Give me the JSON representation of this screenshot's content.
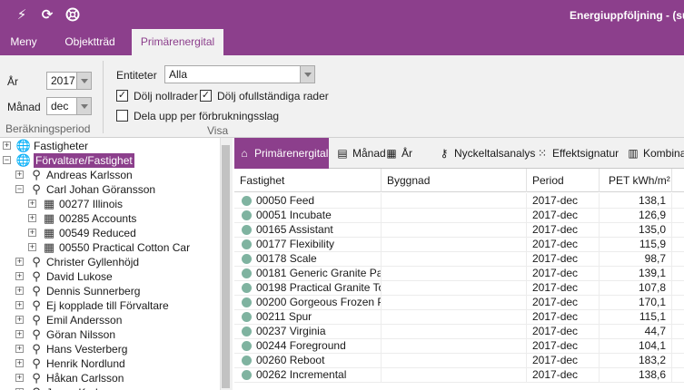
{
  "titlebar": {
    "title": "Energiuppföljning -   (su",
    "quick_icons": [
      "lightning-icon",
      "refresh-icon",
      "lifebuoy-icon"
    ]
  },
  "ribbon_tabs": [
    {
      "label": "Meny"
    },
    {
      "label": "Objektträd"
    },
    {
      "label": "Primärenergital"
    }
  ],
  "ribbon": {
    "year_label": "År",
    "year_value": "2017",
    "month_label": "Månad",
    "month_value": "dec",
    "period_group_label": "Beräkningsperiod",
    "entity_label": "Entiteter",
    "entity_value": "Alla",
    "hide_zero_label": "Dölj nollrader",
    "hide_zero_checked": true,
    "hide_incomplete_label": "Dölj ofullständiga rader",
    "hide_incomplete_checked": true,
    "split_label": "Dela upp per förbrukningsslag",
    "split_checked": false,
    "view_group_label": "Visa"
  },
  "tree": [
    {
      "level": 0,
      "label": "Fastigheter",
      "expander": "+",
      "icon": "globe-icon"
    },
    {
      "level": 0,
      "label": "Förvaltare/Fastighet",
      "expander": "−",
      "icon": "globe-icon",
      "selected": true
    },
    {
      "level": 1,
      "label": "Andreas Karlsson",
      "expander": "+",
      "icon": "manager-icon"
    },
    {
      "level": 1,
      "label": "Carl Johan Göransson",
      "expander": "−",
      "icon": "manager-icon"
    },
    {
      "level": 2,
      "label": "00277 Illinois",
      "expander": "+",
      "icon": "building-icon"
    },
    {
      "level": 2,
      "label": "00285 Accounts",
      "expander": "+",
      "icon": "building-icon"
    },
    {
      "level": 2,
      "label": "00549 Reduced",
      "expander": "+",
      "icon": "building-icon"
    },
    {
      "level": 2,
      "label": "00550 Practical Cotton Car",
      "expander": "+",
      "icon": "building-icon"
    },
    {
      "level": 1,
      "label": "Christer Gyllenhöjd",
      "expander": "+",
      "icon": "manager-icon"
    },
    {
      "level": 1,
      "label": "David Lukose",
      "expander": "+",
      "icon": "manager-icon"
    },
    {
      "level": 1,
      "label": "Dennis Sunnerberg",
      "expander": "+",
      "icon": "manager-icon"
    },
    {
      "level": 1,
      "label": "Ej kopplade till Förvaltare",
      "expander": "+",
      "icon": "manager-icon"
    },
    {
      "level": 1,
      "label": "Emil Andersson",
      "expander": "+",
      "icon": "manager-icon"
    },
    {
      "level": 1,
      "label": "Göran Nilsson",
      "expander": "+",
      "icon": "manager-icon"
    },
    {
      "level": 1,
      "label": "Hans Vesterberg",
      "expander": "+",
      "icon": "manager-icon"
    },
    {
      "level": 1,
      "label": "Henrik Nordlund",
      "expander": "+",
      "icon": "manager-icon"
    },
    {
      "level": 1,
      "label": "Håkan Carlsson",
      "expander": "+",
      "icon": "manager-icon"
    },
    {
      "level": 1,
      "label": "Jonas Karlsson",
      "expander": "+",
      "icon": "manager-icon"
    }
  ],
  "view_tabs": [
    {
      "label": "Primärenergital",
      "icon": "house-icon"
    },
    {
      "label": "Månad",
      "icon": "calendar-31-icon"
    },
    {
      "label": "År",
      "icon": "calendar-365-icon"
    },
    {
      "label": "Nyckeltalsanalys",
      "icon": "key-icon"
    },
    {
      "label": "Effektsignatur",
      "icon": "scatter-icon"
    },
    {
      "label": "Kombinat",
      "icon": "combined-icon"
    }
  ],
  "grid": {
    "columns": [
      "Fastighet",
      "Byggnad",
      "Period",
      "PET kWh/m²"
    ],
    "rows": [
      {
        "fastighet": "00050 Feed",
        "byggnad": "",
        "period": "2017-dec",
        "pet": "138,1"
      },
      {
        "fastighet": "00051 Incubate",
        "byggnad": "",
        "period": "2017-dec",
        "pet": "126,9"
      },
      {
        "fastighet": "00165 Assistant",
        "byggnad": "",
        "period": "2017-dec",
        "pet": "135,0"
      },
      {
        "fastighet": "00177 Flexibility",
        "byggnad": "",
        "period": "2017-dec",
        "pet": "115,9"
      },
      {
        "fastighet": "00178 Scale",
        "byggnad": "",
        "period": "2017-dec",
        "pet": "98,7"
      },
      {
        "fastighet": "00181 Generic Granite Pa...",
        "byggnad": "",
        "period": "2017-dec",
        "pet": "139,1"
      },
      {
        "fastighet": "00198 Practical Granite To...",
        "byggnad": "",
        "period": "2017-dec",
        "pet": "107,8"
      },
      {
        "fastighet": "00200 Gorgeous Frozen P...",
        "byggnad": "",
        "period": "2017-dec",
        "pet": "170,1"
      },
      {
        "fastighet": "00211 Spur",
        "byggnad": "",
        "period": "2017-dec",
        "pet": "115,1"
      },
      {
        "fastighet": "00237 Virginia",
        "byggnad": "",
        "period": "2017-dec",
        "pet": "44,7"
      },
      {
        "fastighet": "00244 Foreground",
        "byggnad": "",
        "period": "2017-dec",
        "pet": "104,1"
      },
      {
        "fastighet": "00260 Reboot",
        "byggnad": "",
        "period": "2017-dec",
        "pet": "183,2"
      },
      {
        "fastighet": "00262 Incremental",
        "byggnad": "",
        "period": "2017-dec",
        "pet": "138,6"
      }
    ]
  },
  "colors": {
    "brand": "#8c3f8c",
    "status_dot": "#7fb3a0"
  }
}
